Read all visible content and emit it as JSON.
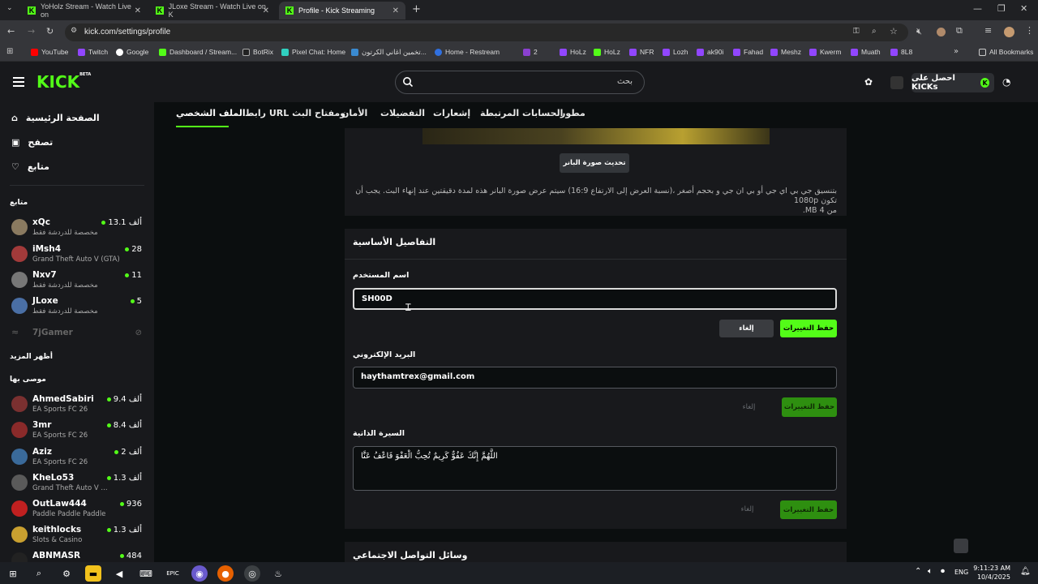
{
  "browser": {
    "tabs": [
      {
        "title": "YoHolz Stream - Watch Live on",
        "active": false
      },
      {
        "title": "JLoxe Stream - Watch Live on K",
        "active": false
      },
      {
        "title": "Profile - Kick Streaming",
        "active": true
      }
    ],
    "url": "kick.com/settings/profile",
    "bookmarks": [
      "YouTube",
      "Twitch",
      "Google",
      "Dashboard / Stream...",
      "BotRix",
      "Pixel Chat: Home",
      "تخمين اغاني الكرتون...",
      "Home - Restream",
      "2",
      "HoLz",
      "HoLz",
      "NFR",
      "Lozh",
      "ak90i",
      "Fahad",
      "Meshz",
      "Kwerm",
      "Muath",
      "8L8"
    ],
    "all_bookmarks": "All Bookmarks"
  },
  "kick": {
    "logo": "KICK",
    "logo_badge": "BETA",
    "search_placeholder": "بحث",
    "kicks_button": "احصل على KICKs"
  },
  "sidebar": {
    "nav": [
      {
        "label": "الصفحة الرئيسية",
        "icon": "home-icon"
      },
      {
        "label": "تصفح",
        "icon": "browse-icon"
      },
      {
        "label": "متابع",
        "icon": "heart-icon"
      }
    ],
    "following_title": "متابع",
    "following": [
      {
        "name": "xQc",
        "category": "مخصصة للدردشة فقط",
        "viewers": "13.1 ألف",
        "avatar_color": "#8a7a60"
      },
      {
        "name": "iMsh4",
        "category": "Grand Theft Auto V (GTA)",
        "viewers": "28",
        "avatar_color": "#a23a3a"
      },
      {
        "name": "Nxv7",
        "category": "مخصصة للدردشة فقط",
        "viewers": "11",
        "avatar_color": "#777777"
      },
      {
        "name": "JLoxe",
        "category": "مخصصة للدردشة فقط",
        "viewers": "5",
        "avatar_color": "#4a6fa5"
      },
      {
        "name": "7jGamer",
        "category": "",
        "viewers": "",
        "avatar_color": "#555555"
      }
    ],
    "show_more": "أظهر المزيد",
    "recommended_title": "موصى بها",
    "recommended": [
      {
        "name": "AhmedSabiri",
        "category": "EA Sports FC 26",
        "viewers": "9.4 ألف",
        "avatar_color": "#7a3030"
      },
      {
        "name": "3mr",
        "category": "EA Sports FC 26",
        "viewers": "8.4 ألف",
        "avatar_color": "#8a2a2a"
      },
      {
        "name": "Aziz",
        "category": "EA Sports FC 26",
        "viewers": "2 ألف",
        "avatar_color": "#3a6a9a"
      },
      {
        "name": "KheLo53",
        "category": "Grand Theft Auto V ...",
        "viewers": "1.3 ألف",
        "avatar_color": "#5a5a5a"
      },
      {
        "name": "OutLaw444",
        "category": "Paddle Paddle Paddle",
        "viewers": "936",
        "avatar_color": "#c02020"
      },
      {
        "name": "keithlocks",
        "category": "Slots & Casino",
        "viewers": "1.3 ألف",
        "avatar_color": "#c9a030"
      },
      {
        "name": "ABNMASR",
        "category": "",
        "viewers": "484",
        "avatar_color": "#222222"
      }
    ]
  },
  "settings_tabs": [
    "الملف الشخصي",
    "رابط URL ومفتاح البث",
    "الأمان",
    "التفضيلات",
    "إشعارات",
    "الحسابات المرتبطة",
    "مطور"
  ],
  "banner": {
    "update_button": "تحديث صورة البانر",
    "hint": "بتنسيق جي بي اي جي أو بي ان جي و بحجم أصغر ،(نسبة العرض إلى الارتفاع 16:9) سيتم عرض صورة البانر هذه لمدة دقيقتين عند إنهاء البث. يجب أن تكون 1080p",
    "hint2": "من 4 MB."
  },
  "basic": {
    "title": "التفاصيل الأساسية",
    "username_label": "اسم المستخدم",
    "username": "SH00D",
    "save": "حفظ التغييرات",
    "cancel": "إلغاء",
    "email_label": "البريد الإلكتروني",
    "email": "haythamtrex@gmail.com",
    "bio_label": "السيرة الذاتية",
    "bio": "اللَّهُمَّ إِنَّكَ عَفُوٌّ كَرِيمٌ تُحِبُّ الْعَفْوَ فَاعْفُ عَنَّا"
  },
  "social": {
    "title": "وسائل التواصل الاجتماعي"
  },
  "taskbar": {
    "lang": "ENG",
    "time": "9:11:23 AM",
    "date": "10/4/2025"
  }
}
